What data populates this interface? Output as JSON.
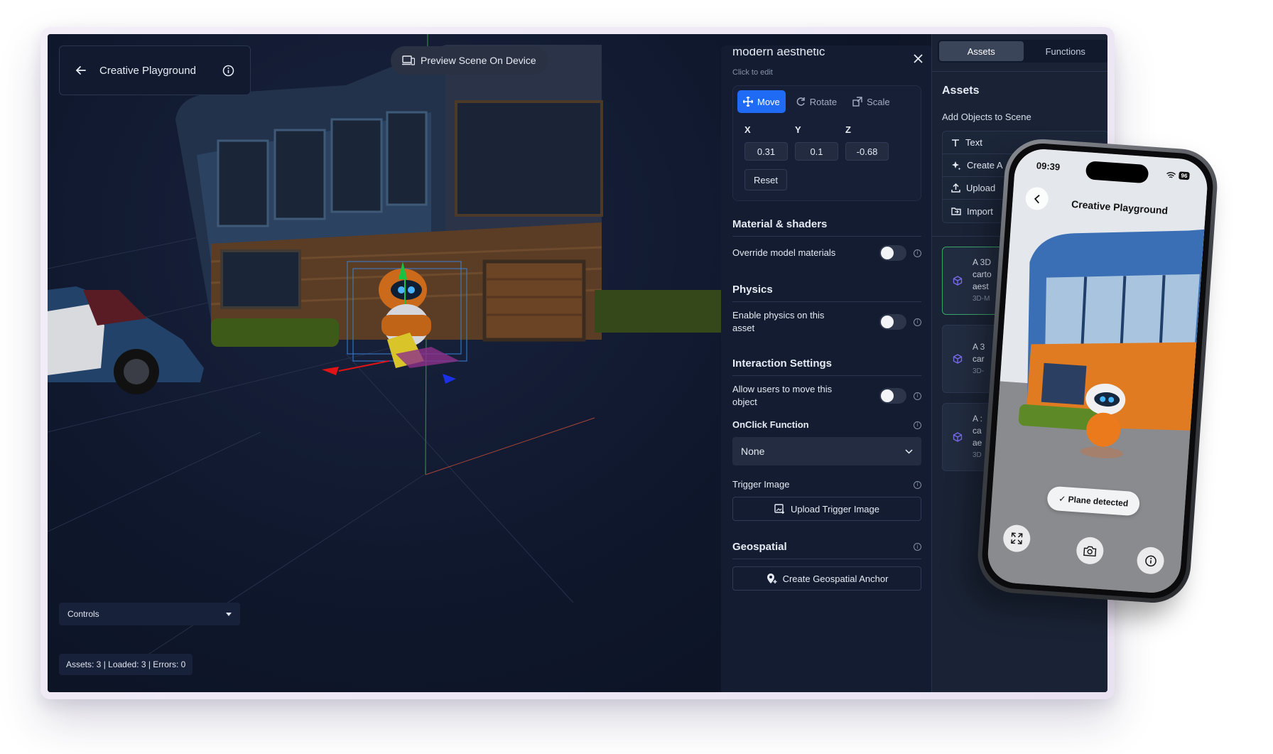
{
  "app": {
    "title": "Creative Playground",
    "preview_label": "Preview Scene On Device"
  },
  "viewport": {
    "controls_label": "Controls",
    "stats": "Assets: 3 | Loaded: 3 | Errors: 0"
  },
  "properties": {
    "asset_name": "modern aesthetic",
    "click_to_edit": "Click to edit",
    "tools": [
      {
        "label": "Move",
        "icon": "move-icon",
        "active": true
      },
      {
        "label": "Rotate",
        "icon": "rotate-icon",
        "active": false
      },
      {
        "label": "Scale",
        "icon": "scale-icon",
        "active": false
      }
    ],
    "axes": [
      {
        "label": "X",
        "value": "0.31"
      },
      {
        "label": "Y",
        "value": "0.1"
      },
      {
        "label": "Z",
        "value": "-0.68"
      }
    ],
    "reset_label": "Reset",
    "material": {
      "title": "Material & shaders",
      "override_label": "Override model materials"
    },
    "physics": {
      "title": "Physics",
      "enable_label": "Enable physics on this asset"
    },
    "interaction": {
      "title": "Interaction Settings",
      "move_label": "Allow users to move this object",
      "onclick_label": "OnClick Function",
      "onclick_value": "None",
      "trigger_label": "Trigger Image",
      "upload_trigger_label": "Upload Trigger Image"
    },
    "geospatial": {
      "title": "Geospatial",
      "anchor_label": "Create Geospatial Anchor"
    }
  },
  "assets_panel": {
    "tabs": [
      {
        "label": "Assets",
        "active": true
      },
      {
        "label": "Functions",
        "active": false
      }
    ],
    "heading": "Assets",
    "add_label": "Add Objects to Scene",
    "add_items": [
      {
        "label": "Text",
        "icon": "text-icon"
      },
      {
        "label": "Create A",
        "icon": "sparkle-icon"
      },
      {
        "label": "Upload",
        "icon": "upload-icon"
      },
      {
        "label": "Import",
        "icon": "import-icon"
      }
    ],
    "cards": [
      {
        "line1": "A 3D",
        "line2": "carto",
        "line3": "aest",
        "line4": "3D-M"
      },
      {
        "line1": "A 3",
        "line2": "car",
        "line3": "",
        "line4": "3D-"
      },
      {
        "line1": "A :",
        "line2": "ca",
        "line3": "ae",
        "line4": "3D"
      }
    ]
  },
  "phone": {
    "time": "09:39",
    "battery": "96",
    "title": "Creative Playground",
    "plane_status": "✓ Plane detected"
  },
  "colors": {
    "accent": "#1f6bf5",
    "panel_bg": "#131c30",
    "viewport_bg": "#0f172c",
    "selected_card_border": "#3aa56a"
  }
}
